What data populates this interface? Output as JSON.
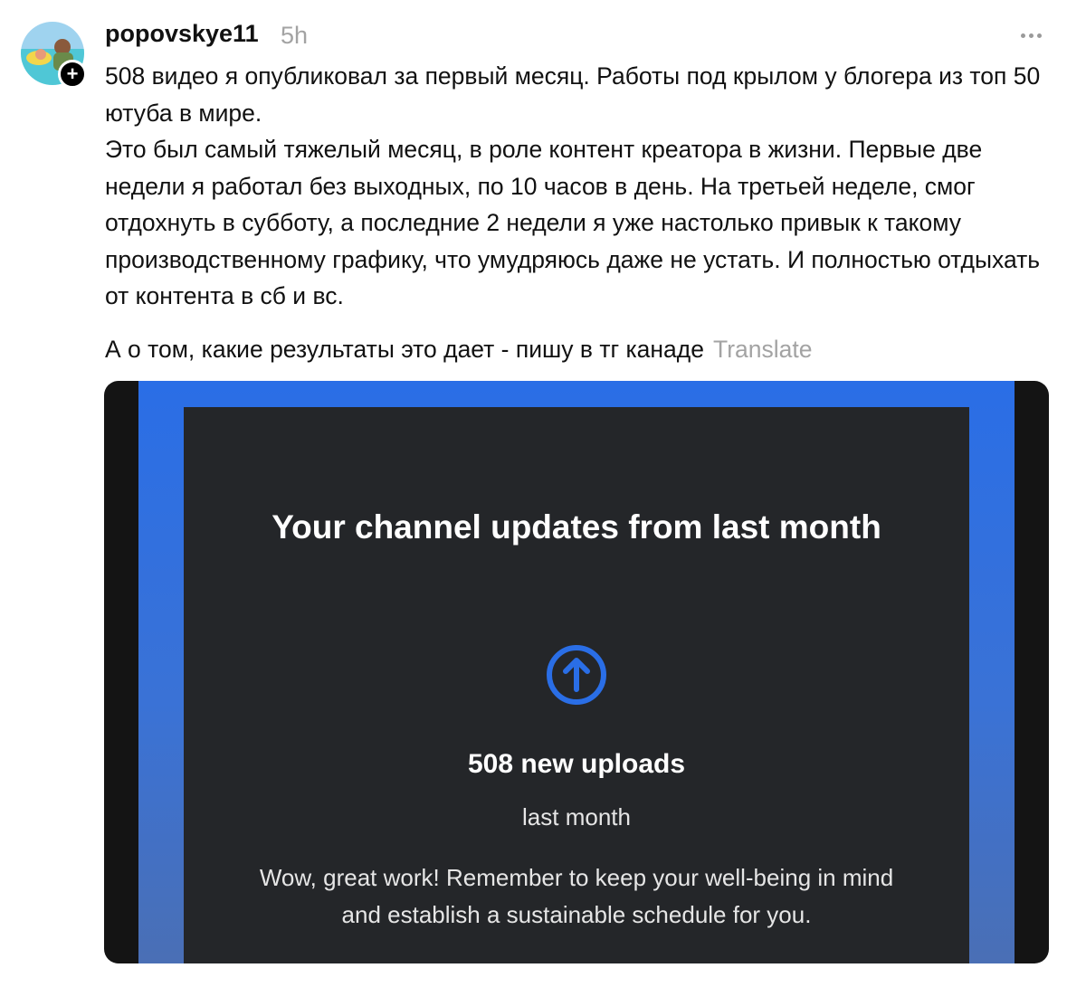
{
  "post": {
    "username": "popovskye11",
    "timestamp": "5h",
    "follow_symbol": "+",
    "paragraph1": "508 видео я опубликовал за первый месяц. Работы под крылом у блогера из топ 50 ютуба в мире.",
    "paragraph2": "Это был самый тяжелый месяц, в роле контент креатора в жизни. Первые две недели я работал без выходных, по 10 часов в день. На третьей неделе, смог отдохнуть в субботу, а последние 2 недели я уже настолько привык к такому производственному графику, что умудряюсь даже не устать. И полностью отдыхать от контента в сб и вс.",
    "paragraph3": "А о том, какие результаты это дает - пишу в тг канаде",
    "translate_label": "Translate"
  },
  "media": {
    "title": "Your channel updates from last month",
    "icon": "upload-arrow-icon",
    "uploads_count": "508 new uploads",
    "uploads_period": "last month",
    "message": "Wow, great work! Remember to keep your well-being in mind and establish a sustainable schedule for you."
  },
  "colors": {
    "accent_blue": "#2a6ee6",
    "card_bg": "#242629",
    "muted_text": "#a3a3a3"
  }
}
